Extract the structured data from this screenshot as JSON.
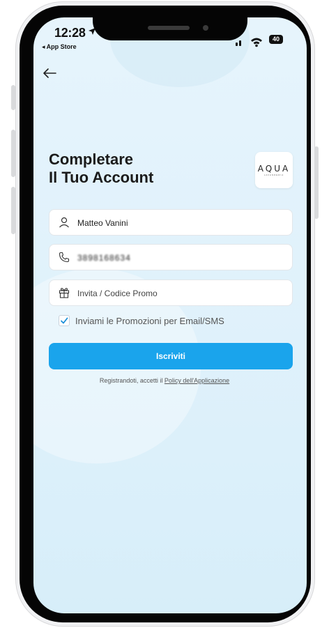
{
  "status_bar": {
    "time": "12:28",
    "back_app": "◂ App Store",
    "battery": "40"
  },
  "header": {
    "title_line1": "Completare",
    "title_line2": "Il Tuo Account",
    "logo_word": "AQUA",
    "logo_sub": "LAVANDERIA"
  },
  "form": {
    "name_value": "Matteo Vanini",
    "phone_value": "3898168634",
    "promo_placeholder": "Invita / Codice Promo",
    "promo_checkbox_label": "Inviami le Promozioni per Email/SMS",
    "promo_checkbox_checked": true,
    "submit_label": "Iscriviti"
  },
  "footer": {
    "policy_prefix": "Registrandoti, accetti il ",
    "policy_link": "Policy dell'Applicazione"
  },
  "colors": {
    "accent": "#1aa4ec",
    "background": "#e2f2fb"
  },
  "icons": [
    "location-arrow-icon",
    "signal-icon",
    "wifi-icon",
    "battery-icon",
    "back-arrow-icon",
    "user-icon",
    "phone-icon",
    "gift-icon",
    "checkmark-icon"
  ]
}
